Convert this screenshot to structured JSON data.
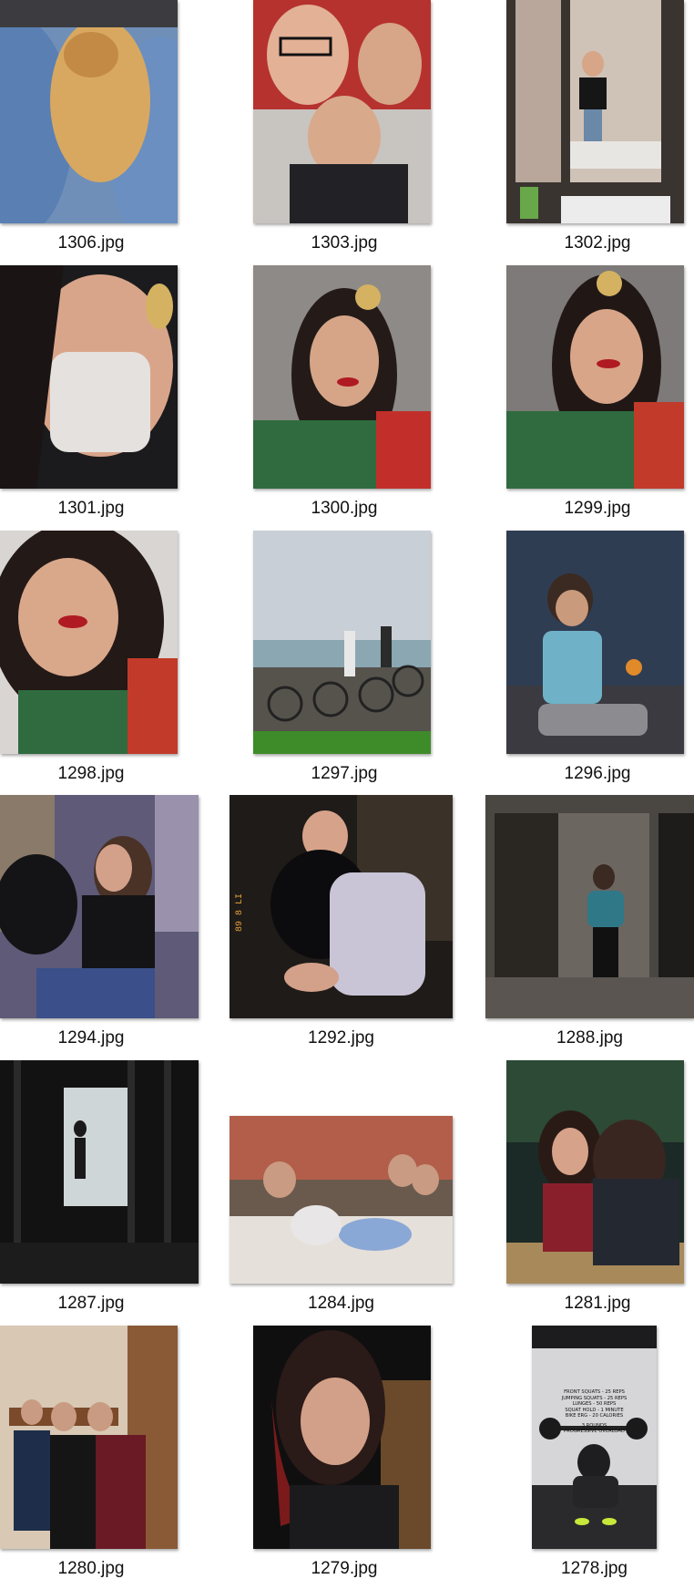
{
  "files": [
    {
      "name": "1306.jpg"
    },
    {
      "name": "1303.jpg"
    },
    {
      "name": "1302.jpg"
    },
    {
      "name": "1301.jpg"
    },
    {
      "name": "1300.jpg"
    },
    {
      "name": "1299.jpg"
    },
    {
      "name": "1298.jpg"
    },
    {
      "name": "1297.jpg"
    },
    {
      "name": "1296.jpg"
    },
    {
      "name": "1294.jpg"
    },
    {
      "name": "1292.jpg"
    },
    {
      "name": "1288.jpg"
    },
    {
      "name": "1287.jpg"
    },
    {
      "name": "1284.jpg"
    },
    {
      "name": "1281.jpg"
    },
    {
      "name": "1280.jpg"
    },
    {
      "name": "1279.jpg"
    },
    {
      "name": "1278.jpg"
    }
  ],
  "overlay_text": {
    "workout": [
      "FRONT SQUATS - 25 REPS",
      "JUMPING SQUATS - 25 REPS",
      "LUNGES - 50 REPS",
      "SQUAT HOLD - 1 MINUTE",
      "BIKE ERG - 20 CALORIES",
      "3 ROUNDS",
      "PROGRESSIVE OVERLOAD"
    ],
    "date_stamp": "89 8 LI"
  },
  "colors": {
    "background": "#ffffff",
    "caption": "#111111"
  }
}
